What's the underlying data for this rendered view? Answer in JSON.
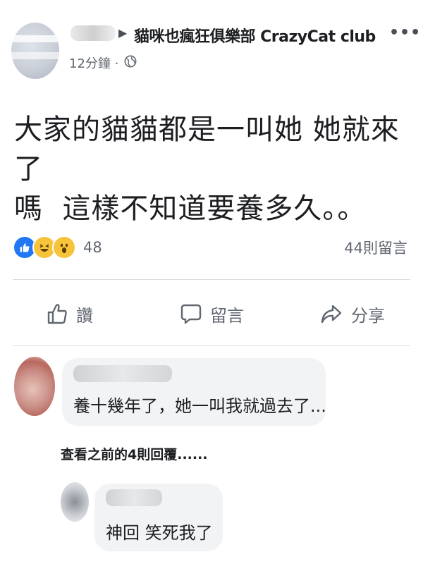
{
  "post": {
    "group_name": "貓咪也瘋狂俱樂部 CrazyCat club",
    "timestamp": "12分鐘 ·",
    "text_line1": "大家的貓貓都是一叫她 她就來了",
    "text_line2": "嗎  這樣不知道要養多久。。",
    "reaction_count": "48",
    "comments_count": "44則留言",
    "icons": {
      "arrow": "triangle-right-icon",
      "more": "more-options-icon",
      "audience": "globe-icon"
    }
  },
  "actions": {
    "like_label": "讚",
    "comment_label": "留言",
    "share_label": "分享"
  },
  "comments": {
    "first_text": "養十幾年了，她一叫我就過去了...",
    "view_previous_replies": "查看之前的4則回覆......",
    "reply_text": "神回 笑死我了"
  },
  "colors": {
    "like_blue": "#2078f4",
    "reaction_yellow": "#f7c33b",
    "secondary_text": "#606770",
    "bubble_bg": "#f2f3f5"
  }
}
